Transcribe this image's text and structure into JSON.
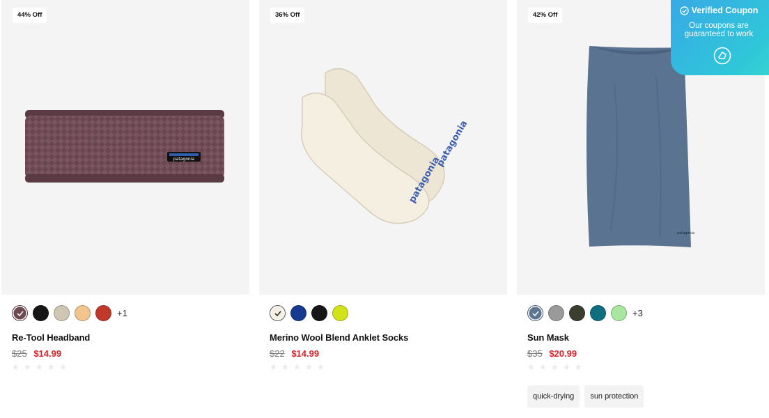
{
  "products": [
    {
      "discount": "44% Off",
      "name": "Re-Tool Headband",
      "old_price": "$25",
      "new_price": "$14.99",
      "swatches": [
        "#6d4a4f",
        "#161616",
        "#cfc6b4",
        "#f2c58e",
        "#c0392b"
      ],
      "more_colors": "+1",
      "tags": []
    },
    {
      "discount": "36% Off",
      "name": "Merino Wool Blend Anklet Socks",
      "old_price": "$22",
      "new_price": "$14.99",
      "swatches": [
        "#f4efe2",
        "#153a8f",
        "#161616",
        "#d3e31a"
      ],
      "more_colors": "",
      "tags": []
    },
    {
      "discount": "42% Off",
      "name": "Sun Mask",
      "old_price": "$35",
      "new_price": "$20.99",
      "swatches": [
        "#5d7590",
        "#9a9a9a",
        "#3a3e2e",
        "#0f6f80",
        "#a9e6a0"
      ],
      "more_colors": "+3",
      "tags": [
        "quick-drying",
        "sun protection"
      ]
    }
  ],
  "coupon": {
    "title": "Verified Coupon",
    "line1": "Our coupons are",
    "line2": "guaranteed to work"
  }
}
